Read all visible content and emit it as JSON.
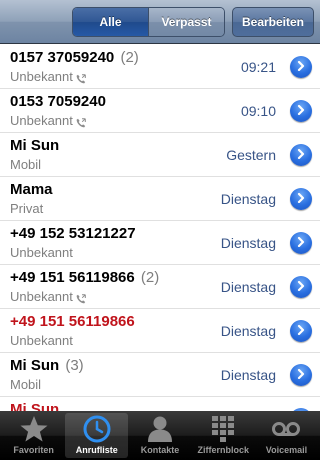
{
  "navbar": {
    "segment_all": "Alle",
    "segment_missed": "Verpasst",
    "edit_label": "Bearbeiten"
  },
  "calls": [
    {
      "name": "0157 37059240",
      "count": "(2)",
      "label": "Unbekannt",
      "time": "09:21",
      "missed": false,
      "phone_icon": true
    },
    {
      "name": "0153 7059240",
      "count": "",
      "label": "Unbekannt",
      "time": "09:10",
      "missed": false,
      "phone_icon": true
    },
    {
      "name": "Mi Sun",
      "count": "",
      "label": "Mobil",
      "time": "Gestern",
      "missed": false,
      "phone_icon": false
    },
    {
      "name": "Mama",
      "count": "",
      "label": "Privat",
      "time": "Dienstag",
      "missed": false,
      "phone_icon": false
    },
    {
      "name": "+49 152 53121227",
      "count": "",
      "label": "Unbekannt",
      "time": "Dienstag",
      "missed": false,
      "phone_icon": false
    },
    {
      "name": "+49 151 56119866",
      "count": "(2)",
      "label": "Unbekannt",
      "time": "Dienstag",
      "missed": false,
      "phone_icon": true
    },
    {
      "name": "+49 151 56119866",
      "count": "",
      "label": "Unbekannt",
      "time": "Dienstag",
      "missed": true,
      "phone_icon": false
    },
    {
      "name": "Mi Sun",
      "count": "(3)",
      "label": "Mobil",
      "time": "Dienstag",
      "missed": false,
      "phone_icon": false
    },
    {
      "name": "Mi Sun",
      "count": "",
      "label": "",
      "time": "",
      "missed": true,
      "phone_icon": false
    }
  ],
  "tabs": [
    {
      "label": "Favoriten",
      "icon": "star-icon",
      "active": false
    },
    {
      "label": "Anrufliste",
      "icon": "clock-icon",
      "active": true
    },
    {
      "label": "Kontakte",
      "icon": "contacts-icon",
      "active": false
    },
    {
      "label": "Ziffernblock",
      "icon": "keypad-icon",
      "active": false
    },
    {
      "label": "Voicemail",
      "icon": "voicemail-icon",
      "active": false
    }
  ],
  "colors": {
    "missed": "#c0141c",
    "accent": "#385487",
    "nav": "#6d84a2"
  }
}
